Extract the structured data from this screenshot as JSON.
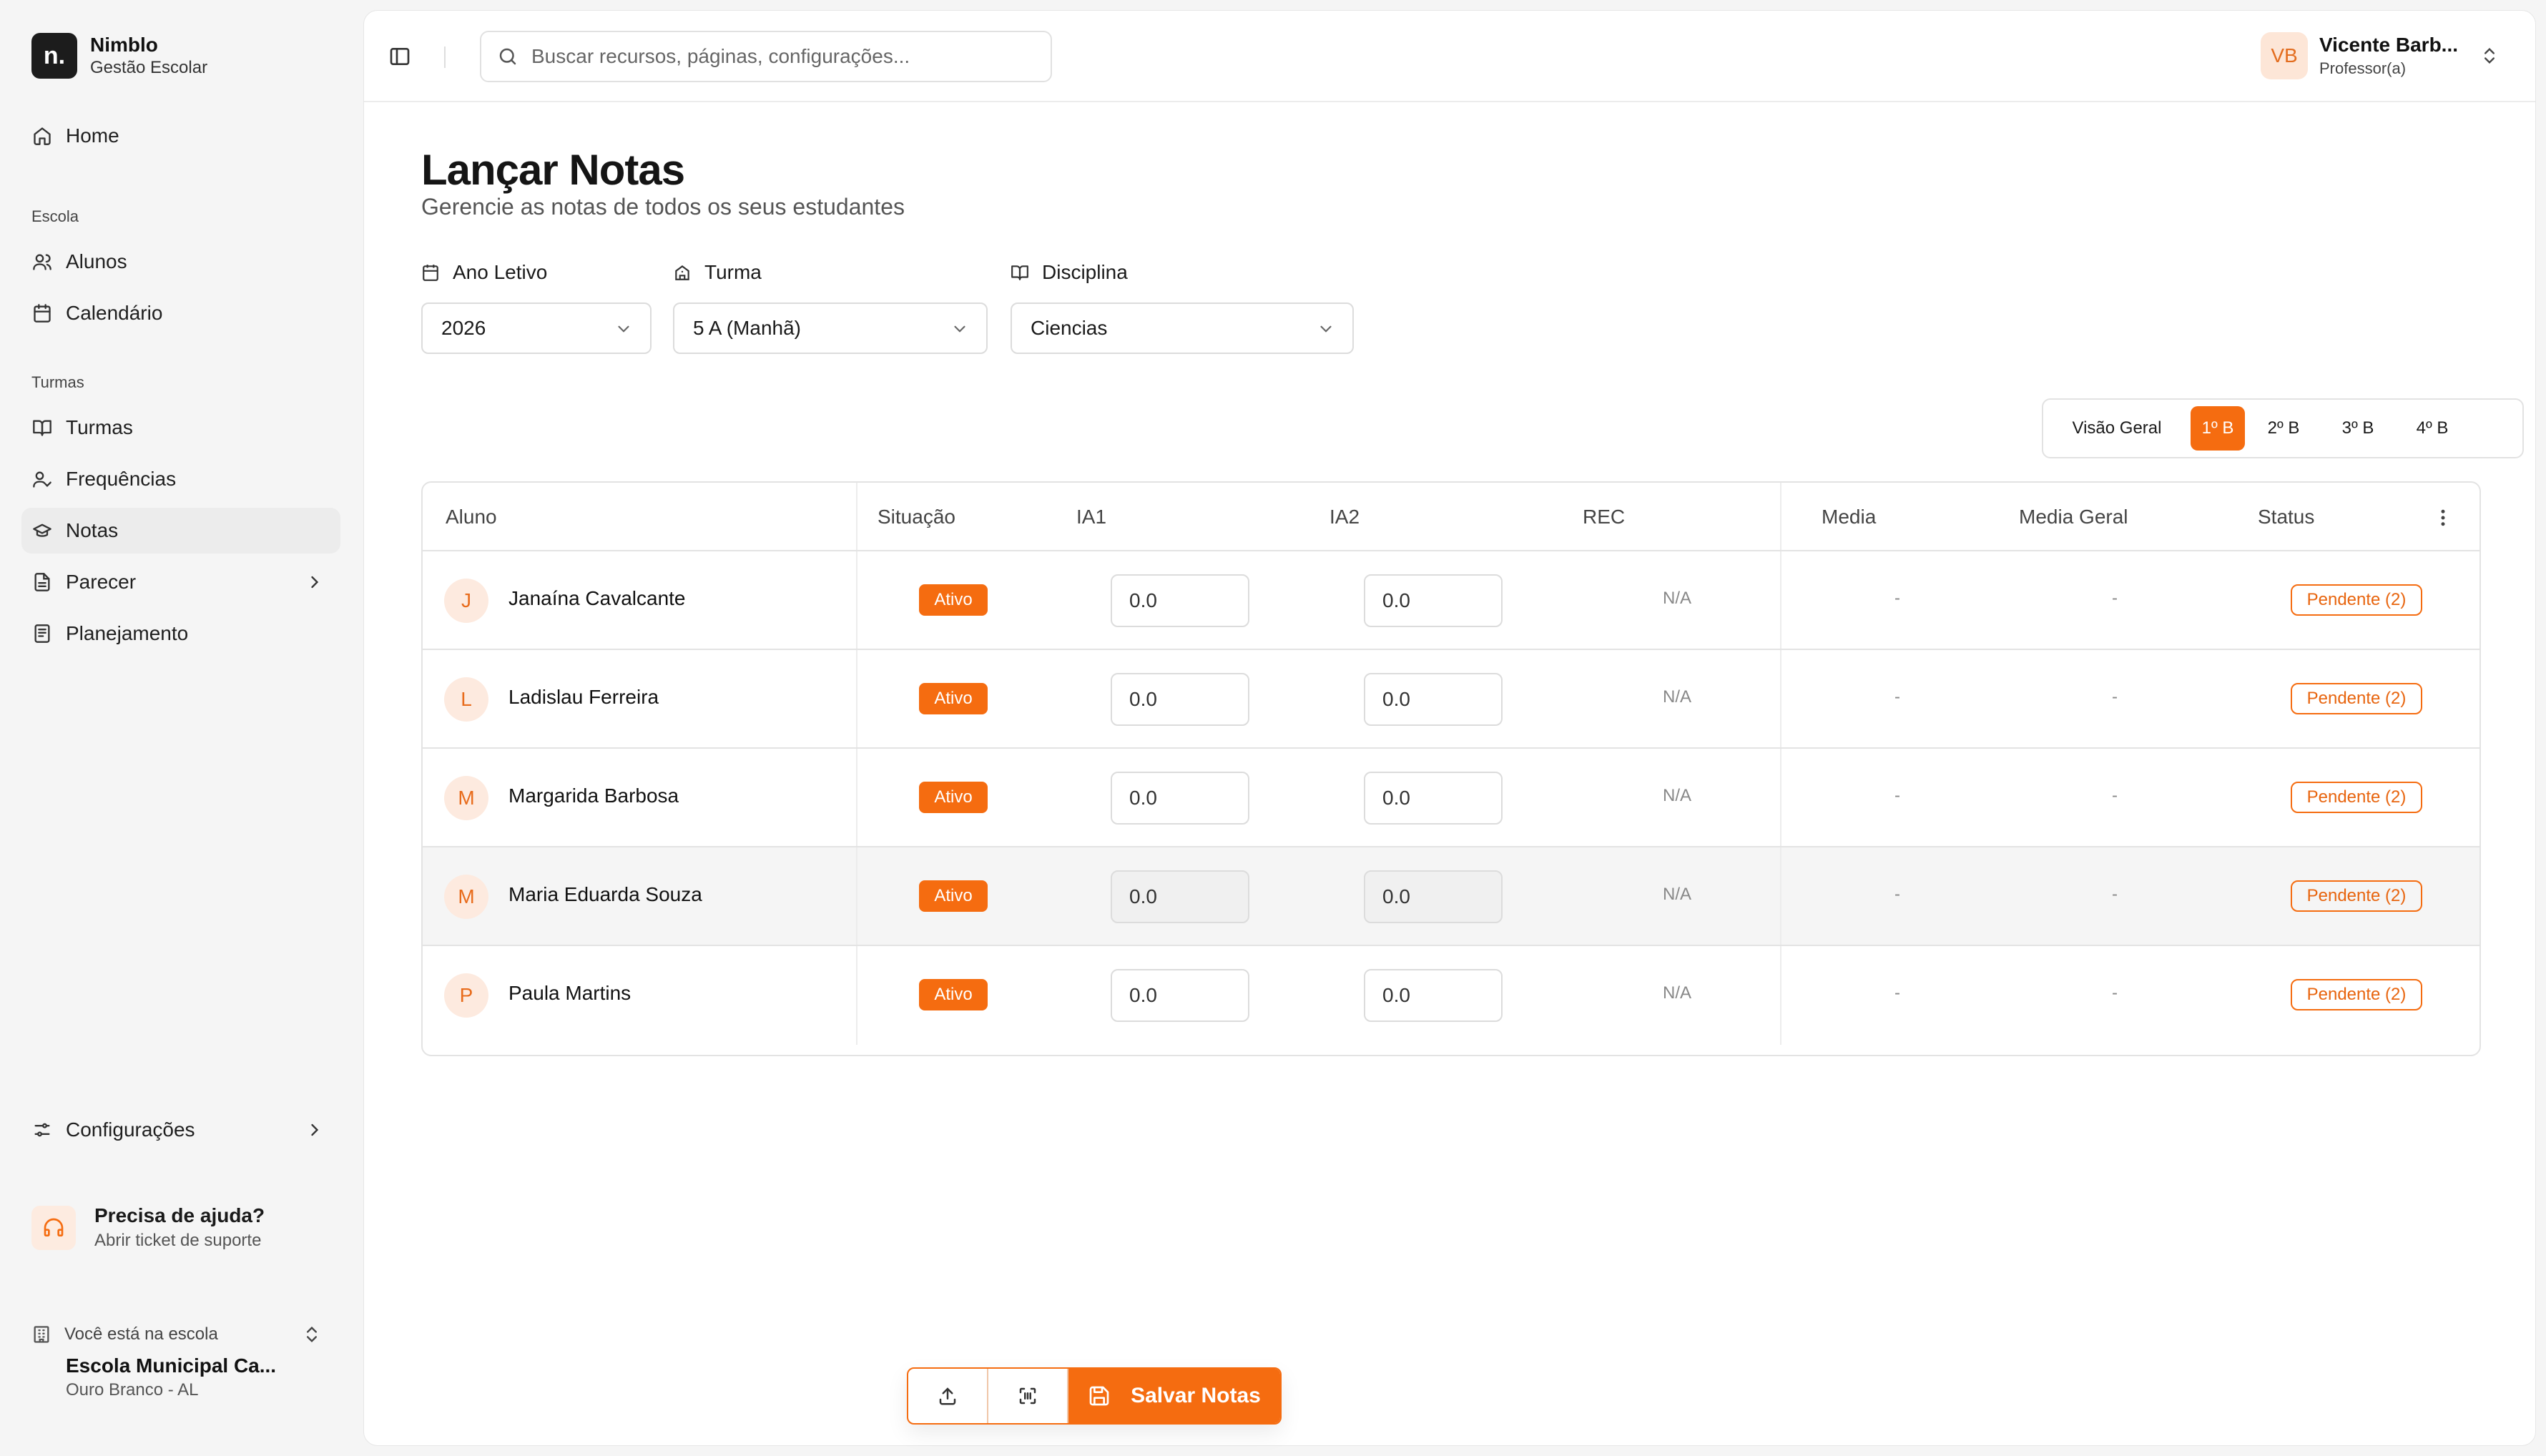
{
  "brand": {
    "logo_text": "n.",
    "name": "Nimblo",
    "subtitle": "Gestão Escolar"
  },
  "sidebar": {
    "home": "Home",
    "section_escola": "Escola",
    "alunos": "Alunos",
    "calendario": "Calendário",
    "section_turmas": "Turmas",
    "turmas": "Turmas",
    "frequencias": "Frequências",
    "notas": "Notas",
    "parecer": "Parecer",
    "planejamento": "Planejamento",
    "configuracoes": "Configurações",
    "active_item": "Notas"
  },
  "help": {
    "title": "Precisa de ajuda?",
    "subtitle": "Abrir ticket de suporte"
  },
  "school": {
    "label": "Você está na escola",
    "name": "Escola Municipal Ca...",
    "city": "Ouro Branco - AL"
  },
  "topbar": {
    "search_placeholder": "Buscar recursos, páginas, configurações...",
    "user_initials": "VB",
    "user_name": "Vicente Barb...",
    "user_role": "Professor(a)"
  },
  "page": {
    "title": "Lançar Notas",
    "subtitle": "Gerencie as notas de todos os seus estudantes"
  },
  "filters": {
    "ano_label": "Ano Letivo",
    "ano_value": "2026",
    "turma_label": "Turma",
    "turma_value": "5 A (Manhã)",
    "disciplina_label": "Disciplina",
    "disciplina_value": "Ciencias"
  },
  "bimestre_tabs": [
    "Visão Geral",
    "1º B",
    "2º B",
    "3º B",
    "4º B"
  ],
  "active_bimestre": "1º B",
  "table": {
    "headers": {
      "aluno": "Aluno",
      "situacao": "Situação",
      "ia1": "IA1",
      "ia2": "IA2",
      "rec": "REC",
      "media": "Media",
      "media_geral": "Media Geral",
      "status": "Status"
    },
    "rows": [
      {
        "initial": "J",
        "name": "Janaína Cavalcante",
        "situacao": "Ativo",
        "ia1": "0.0",
        "ia2": "0.0",
        "rec": "N/A",
        "media": "-",
        "media_geral": "-",
        "status": "Pendente (2)"
      },
      {
        "initial": "L",
        "name": "Ladislau Ferreira",
        "situacao": "Ativo",
        "ia1": "0.0",
        "ia2": "0.0",
        "rec": "N/A",
        "media": "-",
        "media_geral": "-",
        "status": "Pendente (2)"
      },
      {
        "initial": "M",
        "name": "Margarida Barbosa",
        "situacao": "Ativo",
        "ia1": "0.0",
        "ia2": "0.0",
        "rec": "N/A",
        "media": "-",
        "media_geral": "-",
        "status": "Pendente (2)"
      },
      {
        "initial": "M",
        "name": "Maria Eduarda Souza",
        "situacao": "Ativo",
        "ia1": "0.0",
        "ia2": "0.0",
        "rec": "N/A",
        "media": "-",
        "media_geral": "-",
        "status": "Pendente (2)"
      },
      {
        "initial": "P",
        "name": "Paula Martins",
        "situacao": "Ativo",
        "ia1": "0.0",
        "ia2": "0.0",
        "rec": "N/A",
        "media": "-",
        "media_geral": "-",
        "status": "Pendente (2)"
      }
    ]
  },
  "actions": {
    "save_label": "Salvar Notas"
  },
  "colors": {
    "accent": "#f56c10",
    "accent_light": "#fdeadf",
    "sidebar_bg": "#f5f5f5",
    "panel_bg": "#ffffff"
  },
  "icons": [
    "home-icon",
    "users-icon",
    "calendar-icon",
    "book-icon",
    "user-check-icon",
    "graduation-icon",
    "file-text-icon",
    "settings-icon",
    "headset-icon",
    "building-icon",
    "search-icon",
    "sidebar-toggle-icon",
    "upload-icon",
    "scan-icon",
    "save-icon",
    "kebab-icon"
  ]
}
